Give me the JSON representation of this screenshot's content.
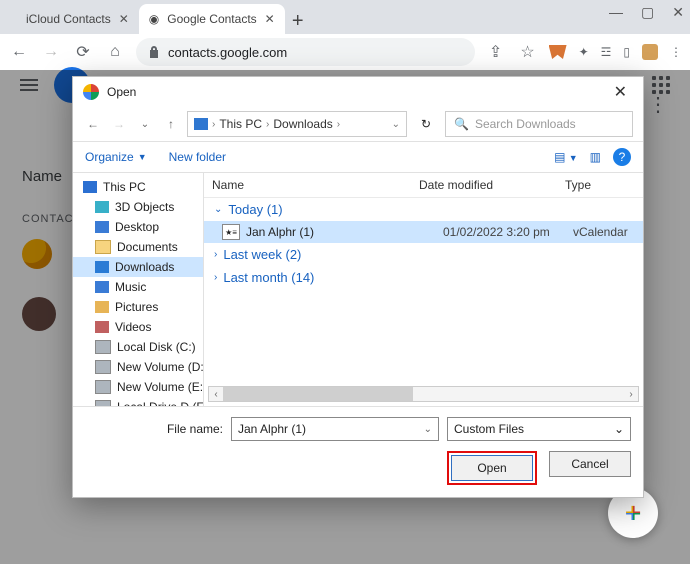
{
  "tabs": {
    "items": [
      {
        "title": "iCloud Contacts",
        "active": false
      },
      {
        "title": "Google Contacts",
        "active": true
      }
    ]
  },
  "address": {
    "url": "contacts.google.com"
  },
  "page": {
    "name_header": "Name",
    "contacts_label": "CONTACTS"
  },
  "dialog": {
    "title": "Open",
    "path": {
      "level1": "This PC",
      "level2": "Downloads"
    },
    "search_placeholder": "Search Downloads",
    "organize": "Organize",
    "newfolder": "New folder",
    "tree": {
      "thispc": "This PC",
      "objects3d": "3D Objects",
      "desktop": "Desktop",
      "documents": "Documents",
      "downloads": "Downloads",
      "music": "Music",
      "pictures": "Pictures",
      "videos": "Videos",
      "localc": "Local Disk (C:)",
      "voldd": "New Volume (D:)",
      "vole": "New Volume (E:)",
      "volf": "Local Drive D (F:)"
    },
    "columns": {
      "name": "Name",
      "date": "Date modified",
      "type": "Type"
    },
    "groups": {
      "today": "Today (1)",
      "lastweek": "Last week (2)",
      "lastmonth": "Last month (14)"
    },
    "file": {
      "name": "Jan Alphr (1)",
      "date": "01/02/2022 3:20 pm",
      "type": "vCalendar"
    },
    "fn_label": "File name:",
    "fn_value": "Jan Alphr (1)",
    "filter_value": "Custom Files",
    "buttons": {
      "open": "Open",
      "cancel": "Cancel"
    }
  }
}
